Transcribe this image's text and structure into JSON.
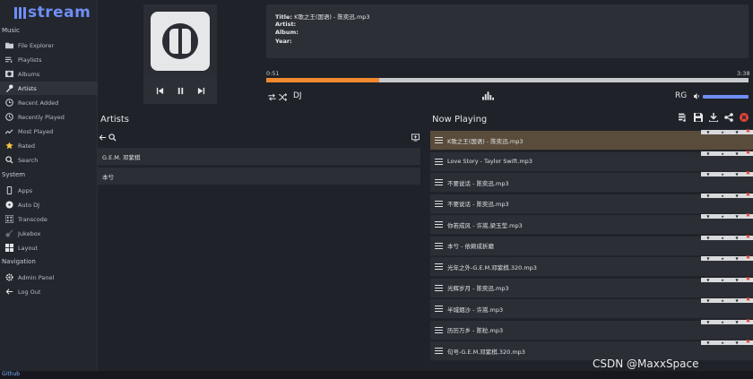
{
  "app": {
    "logo_text": "stream"
  },
  "sidebar": {
    "sections": [
      {
        "title": "Music",
        "items": [
          {
            "label": "File Explorer",
            "icon": "folder-icon"
          },
          {
            "label": "Playlists",
            "icon": "playlist-icon"
          },
          {
            "label": "Albums",
            "icon": "album-icon"
          },
          {
            "label": "Artists",
            "icon": "microphone-icon",
            "active": true
          },
          {
            "label": "Recent Added",
            "icon": "clock-icon"
          },
          {
            "label": "Recently Played",
            "icon": "history-icon"
          },
          {
            "label": "Most Played",
            "icon": "trending-icon"
          },
          {
            "label": "Rated",
            "icon": "star-icon"
          },
          {
            "label": "Search",
            "icon": "search-icon"
          }
        ]
      },
      {
        "title": "System",
        "items": [
          {
            "label": "Apps",
            "icon": "phone-icon"
          },
          {
            "label": "Auto DJ",
            "icon": "disc-icon"
          },
          {
            "label": "Transcode",
            "icon": "transcode-icon"
          },
          {
            "label": "Jukebox",
            "icon": "guitar-icon"
          },
          {
            "label": "Layout",
            "icon": "grid-icon"
          }
        ]
      },
      {
        "title": "Navigation",
        "items": [
          {
            "label": "Admin Panel",
            "icon": "gear-icon"
          },
          {
            "label": "Log Out",
            "icon": "arrow-left-icon"
          }
        ]
      }
    ],
    "github_link": "Github"
  },
  "player": {
    "title_label": "Title:",
    "title_value": "K歌之王(国语) - 陈奕迅.mp3",
    "artist_label": "Artist:",
    "artist_value": "",
    "album_label": "Album:",
    "album_value": "",
    "year_label": "Year:",
    "year_value": "",
    "current_time": "0:51",
    "total_time": "3:38",
    "progress_fraction": 0.235,
    "dj_label": "DJ",
    "rg_label": "RG",
    "volume_fraction": 1.0
  },
  "artists": {
    "title": "Artists",
    "rows": [
      "G.E.M. 邓紫棋",
      "本兮"
    ]
  },
  "now_playing": {
    "title": "Now Playing",
    "rows": [
      "K歌之王(国语) - 陈奕迅.mp3",
      "Love Story - Taylor Swift.mp3",
      "不要说话 - 陈奕迅.mp3",
      "不要说话 - 陈奕迅.mp3",
      "你若成风 - 许嵩,梁玉莹.mp3",
      "本兮 - 依赖成折磨",
      "光年之外-G.E.M.邓紫棋.320.mp3",
      "光辉岁月 - 陈奕迅.mp3",
      "半城烟沙 - 许嵩.mp3",
      "历历万乡 - 陈粒.mp3",
      "句号-G.E.M.邓紫棋.320.mp3"
    ],
    "current_index": 0
  },
  "colors": {
    "accent": "#6f8ef5",
    "progress": "#ef8a2f",
    "current_row": "#5a4c3a",
    "delete": "#e0443b"
  },
  "watermark": "CSDN @MaxxSpace"
}
